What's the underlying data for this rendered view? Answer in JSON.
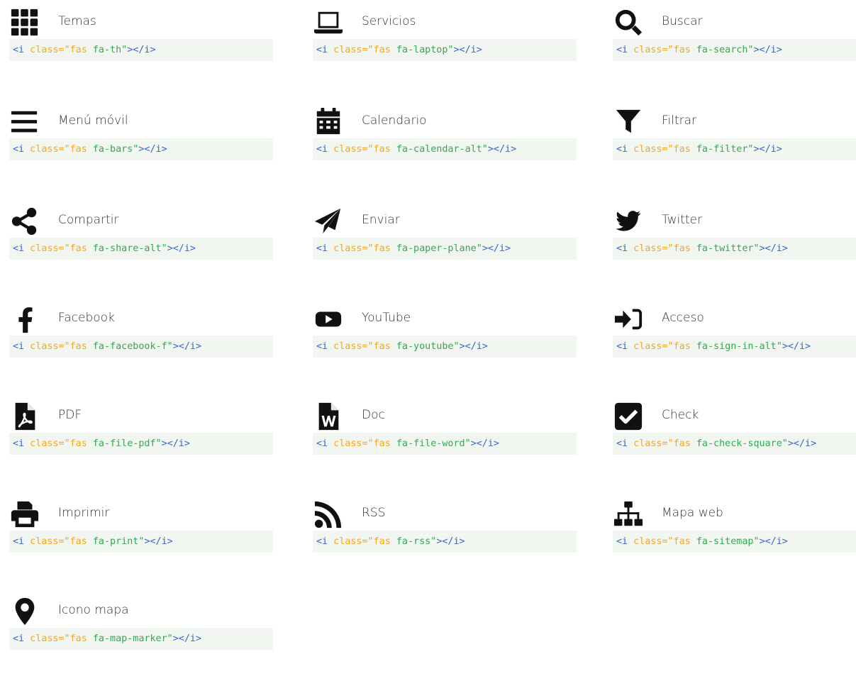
{
  "icons": [
    {
      "icon": "th-icon",
      "label": "Temas",
      "attr": " class=\"fas ",
      "cls": "fa-th\"",
      "close": "></i>"
    },
    {
      "icon": "laptop-icon",
      "label": "Servicios",
      "attr": " class=\"fas ",
      "cls": "fa-laptop\"",
      "close": "></i>"
    },
    {
      "icon": "search-icon",
      "label": "Buscar",
      "attr": " class=\"fas ",
      "cls": "fa-search\"",
      "close": "></i>"
    },
    {
      "icon": "bars-icon",
      "label": "Menú móvil",
      "attr": " class=\"fas ",
      "cls": "fa-bars\"",
      "close": "></i>"
    },
    {
      "icon": "calendar-alt-icon",
      "label": "Calendario",
      "attr": " class=\"fas ",
      "cls": "fa-calendar-alt\"",
      "close": "></i>"
    },
    {
      "icon": "filter-icon",
      "label": "Filtrar",
      "attr": " class=\"fas ",
      "cls": "fa-filter\"",
      "close": "></i>"
    },
    {
      "icon": "share-alt-icon",
      "label": "Compartir",
      "attr": " class=\"fas ",
      "cls": "fa-share-alt\"",
      "close": "></i>"
    },
    {
      "icon": "paper-plane-icon",
      "label": "Enviar",
      "attr": " class=\"fas ",
      "cls": "fa-paper-plane\"",
      "close": "></i>"
    },
    {
      "icon": "twitter-icon",
      "label": "Twitter",
      "attr": " class=\"fas ",
      "cls": "fa-twitter\"",
      "close": "></i>"
    },
    {
      "icon": "facebook-f-icon",
      "label": "Facebook",
      "attr": " class=\"fas ",
      "cls": "fa-facebook-f\"",
      "close": "></i>"
    },
    {
      "icon": "youtube-icon",
      "label": "YouTube",
      "attr": " class=\"fas ",
      "cls": "fa-youtube\"",
      "close": "></i>"
    },
    {
      "icon": "sign-in-alt-icon",
      "label": "Acceso",
      "attr": " class=\"fas ",
      "cls": "fa-sign-in-alt\"",
      "close": "></i>"
    },
    {
      "icon": "file-pdf-icon",
      "label": "PDF",
      "attr": " class=\"fas ",
      "cls": "fa-file-pdf\"",
      "close": "></i>"
    },
    {
      "icon": "file-word-icon",
      "label": "Doc",
      "attr": " class=\"fas ",
      "cls": "fa-file-word\"",
      "close": "></i>"
    },
    {
      "icon": "check-square-icon",
      "label": "Check",
      "attr": " class=\"fas ",
      "cls": "fa-check-square\"",
      "close": "></i>"
    },
    {
      "icon": "print-icon",
      "label": "Imprimir",
      "attr": " class=\"fas ",
      "cls": "fa-print\"",
      "close": "></i>"
    },
    {
      "icon": "rss-icon",
      "label": "RSS",
      "attr": " class=\"fas ",
      "cls": "fa-rss\"",
      "close": "></i>"
    },
    {
      "icon": "sitemap-icon",
      "label": "Mapa web",
      "attr": " class=\"fas ",
      "cls": "fa-sitemap\"",
      "close": "></i>"
    },
    {
      "icon": "map-marker-icon",
      "label": "Icono mapa",
      "attr": " class=\"fas ",
      "cls": "fa-map-marker\"",
      "close": "></i>"
    }
  ],
  "code_tag_open": "<i",
  "colors": {
    "tag": "#3a68c4",
    "attr": "#f5a623",
    "value": "#34a853",
    "code_bg": "#f2f6f1"
  }
}
